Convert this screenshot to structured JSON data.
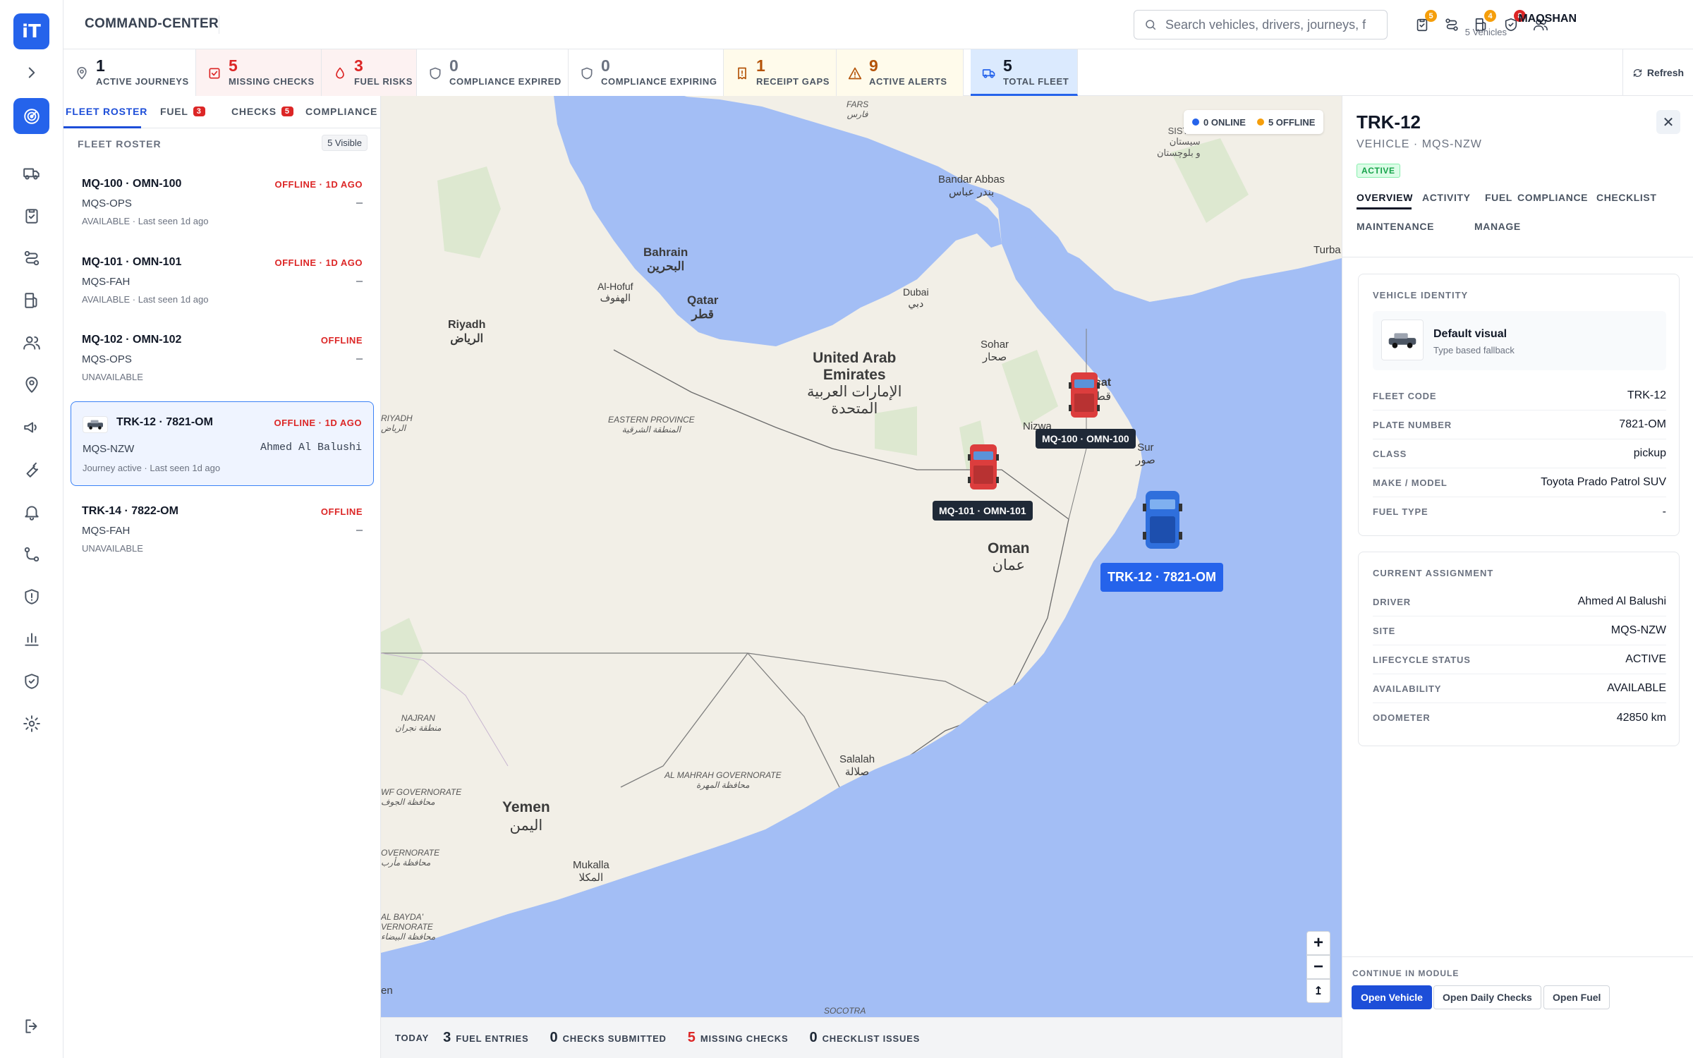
{
  "app": {
    "brand": "COMMAND-CENTER",
    "logo": "iT"
  },
  "search": {
    "placeholder": "Search vehicles, drivers, journeys, f"
  },
  "topbar": {
    "user_name": "MAQSHAN",
    "user_sub": "5 Vehicles",
    "avatar": "MA",
    "icons": [
      {
        "name": "checklist-icon",
        "badge": "5",
        "badge_color": "#f59e0b"
      },
      {
        "name": "route-icon",
        "badge": ""
      },
      {
        "name": "fuel-icon",
        "badge": "4",
        "badge_color": "#f59e0b"
      },
      {
        "name": "shield-icon",
        "badge": "8",
        "badge_color": "#dc2626"
      },
      {
        "name": "users-icon",
        "badge": ""
      }
    ]
  },
  "stats": [
    {
      "value": "1",
      "label": "ACTIVE JOURNEYS",
      "color": "#111827",
      "bg": "#ffffff",
      "icon": "pin-icon"
    },
    {
      "value": "5",
      "label": "MISSING CHECKS",
      "color": "#dc2626",
      "bg": "#fdf2f2",
      "icon": "checkbox-icon"
    },
    {
      "value": "3",
      "label": "FUEL RISKS",
      "color": "#dc2626",
      "bg": "#fdf2f2",
      "icon": "drop-icon"
    },
    {
      "value": "0",
      "label": "COMPLIANCE EXPIRED",
      "color": "#6b7280",
      "bg": "#ffffff",
      "icon": "shield-icon"
    },
    {
      "value": "0",
      "label": "COMPLIANCE EXPIRING",
      "color": "#6b7280",
      "bg": "#ffffff",
      "icon": "shield-icon"
    },
    {
      "value": "1",
      "label": "RECEIPT GAPS",
      "color": "#b45309",
      "bg": "#fffbeb",
      "icon": "receipt-icon"
    },
    {
      "value": "9",
      "label": "ACTIVE ALERTS",
      "color": "#b45309",
      "bg": "#fffbeb",
      "icon": "warning-icon"
    },
    {
      "value": "5",
      "label": "TOTAL FLEET",
      "color": "#111827",
      "bg": "#dbeafe",
      "icon": "truck-icon"
    }
  ],
  "refresh_label": "Refresh",
  "left": {
    "tabs": [
      {
        "label": "FLEET ROSTER",
        "count": ""
      },
      {
        "label": "FUEL",
        "count": "3"
      },
      {
        "label": "CHECKS",
        "count": "5"
      },
      {
        "label": "COMPLIANCE",
        "count": ""
      }
    ],
    "heading": "FLEET ROSTER",
    "visible": "5 Visible",
    "vehicles": [
      {
        "title": "MQ-100 · OMN-100",
        "status": "OFFLINE · 1D AGO",
        "site": "MQS-OPS",
        "driver": "—",
        "meta": "AVAILABLE · Last seen 1d ago"
      },
      {
        "title": "MQ-101 · OMN-101",
        "status": "OFFLINE · 1D AGO",
        "site": "MQS-FAH",
        "driver": "—",
        "meta": "AVAILABLE · Last seen 1d ago"
      },
      {
        "title": "MQ-102 · OMN-102",
        "status": "OFFLINE",
        "site": "MQS-OPS",
        "driver": "—",
        "meta": "UNAVAILABLE"
      },
      {
        "title": "TRK-12 · 7821-OM",
        "status": "OFFLINE · 1D AGO",
        "site": "MQS-NZW",
        "driver": "Ahmed Al Balushi",
        "meta": "Journey active · Last seen 1d ago"
      },
      {
        "title": "TRK-14 · 7822-OM",
        "status": "OFFLINE",
        "site": "MQS-FAH",
        "driver": "—",
        "meta": "UNAVAILABLE"
      }
    ]
  },
  "map": {
    "online": "0 ONLINE",
    "offline": "5 OFFLINE",
    "online_color": "#2563eb",
    "offline_color": "#f59e0b",
    "markers": [
      "MQ-100 · OMN-100",
      "MQ-101 · OMN-101",
      "TRK-12 · 7821-OM"
    ],
    "labels": {
      "fars": "FARS",
      "fars_ar": "فارس",
      "sistan": "SISTAN",
      "sistan_ar": "سیستان",
      "sistan_ar2": "و بلوچستان",
      "bandar": "Bandar Abbas",
      "bandar_ar": "بندر عباس",
      "bahrain": "Bahrain",
      "bahrain_ar": "البحرين",
      "qatar": "Qatar",
      "qatar_ar": "قطر",
      "alhofuf": "Al-Hofuf",
      "alhofuf_ar": "الهفوف",
      "riyadh": "Riyadh",
      "riyadh_ar": "الرياض",
      "riyadh_prov": "RIYADH",
      "riyadh_prov_ar": "الرياض",
      "dubai": "Dubai",
      "dubai_ar": "دبي",
      "uae1": "United Arab",
      "uae2": "Emirates",
      "uae_ar1": "الإمارات العربية",
      "uae_ar2": "المتحدة",
      "sohar": "Sohar",
      "sohar_ar": "صحار",
      "muscat": "cat",
      "muscat_ar": "قط",
      "nizwa": "Nizwa",
      "sur": "Sur",
      "sur_ar": "صور",
      "eastern": "EASTERN PROVINCE",
      "eastern_ar": "المنطقة الشرقية",
      "oman": "Oman",
      "oman_ar": "عمان",
      "turbat": "Turba",
      "najran": "NAJRAN",
      "najran_ar": "منطقة نجران",
      "mahrah": "AL MAHRAH GOVERNORATE",
      "mahrah_ar": "محافظة المهرة",
      "salalah": "Salalah",
      "salalah_ar": "صلالة",
      "yemen": "Yemen",
      "yemen_ar": "اليمن",
      "jawf": "WF GOVERNORATE",
      "jawf_ar": "محافظة الجوف",
      "overnorate": "OVERNORATE",
      "overnorate_ar": "محافظة مأرب",
      "bayda": "AL BAYDA'",
      "bayda2": "VERNORATE",
      "bayda_ar": "محافظة البيضاء",
      "mukalla": "Mukalla",
      "mukalla_ar": "المكلا",
      "socotra": "SOCOTRA",
      "aden": "en"
    }
  },
  "bottom": [
    {
      "value": "",
      "label": "TODAY",
      "color": "#374151"
    },
    {
      "value": "3",
      "label": "FUEL ENTRIES",
      "color": "#111827"
    },
    {
      "value": "0",
      "label": "CHECKS SUBMITTED",
      "color": "#111827"
    },
    {
      "value": "5",
      "label": "MISSING CHECKS",
      "color": "#dc2626"
    },
    {
      "value": "0",
      "label": "CHECKLIST ISSUES",
      "color": "#111827"
    }
  ],
  "right": {
    "title": "TRK-12",
    "subtitle": "VEHICLE · MQS-NZW",
    "status": "ACTIVE",
    "tabs": [
      "OVERVIEW",
      "ACTIVITY",
      "FUEL",
      "COMPLIANCE",
      "CHECKLIST",
      "MAINTENANCE",
      "MANAGE"
    ],
    "identity": {
      "heading": "VEHICLE IDENTITY",
      "visual_title": "Default visual",
      "visual_sub": "Type based fallback",
      "rows": [
        {
          "k": "FLEET CODE",
          "v": "TRK-12"
        },
        {
          "k": "PLATE NUMBER",
          "v": "7821-OM"
        },
        {
          "k": "CLASS",
          "v": "pickup"
        },
        {
          "k": "MAKE / MODEL",
          "v": "Toyota Prado Patrol SUV"
        },
        {
          "k": "FUEL TYPE",
          "v": "-"
        }
      ]
    },
    "assignment": {
      "heading": "CURRENT ASSIGNMENT",
      "rows": [
        {
          "k": "DRIVER",
          "v": "Ahmed Al Balushi"
        },
        {
          "k": "SITE",
          "v": "MQS-NZW"
        },
        {
          "k": "LIFECYCLE STATUS",
          "v": "ACTIVE"
        },
        {
          "k": "AVAILABILITY",
          "v": "AVAILABLE"
        },
        {
          "k": "ODOMETER",
          "v": "42850 km"
        }
      ]
    },
    "footer": {
      "heading": "CONTINUE IN MODULE",
      "buttons": [
        "Open Vehicle",
        "Open Daily Checks",
        "Open Fuel"
      ]
    }
  }
}
